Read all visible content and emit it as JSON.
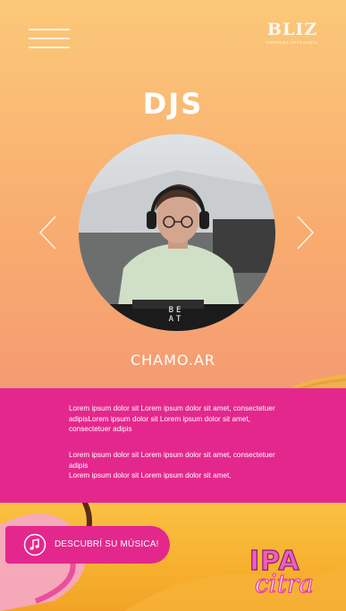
{
  "header": {
    "logo_text": "BLIZ",
    "logo_subtext": "CERVEZA ARTESANAL"
  },
  "page_title": "DJS",
  "dj": {
    "name": "CHAMO.AR",
    "shirt_text": "BE AT"
  },
  "description": {
    "paragraph_1": "Lorem ipsum dolor sit Lorem ipsum dolor sit amet, consectetuer adipisLorem ipsum dolor sit Lorem ipsum dolor sit amet, consectetuer adipis",
    "paragraph_2": "Lorem ipsum dolor sit Lorem ipsum dolor sit amet, consectetuer adipis\nLorem ipsum dolor sit Lorem ipsum dolor sit amet,"
  },
  "cta": {
    "label": "DESCUBRÍ SU MÚSICA!",
    "icon": "music-note-icon"
  },
  "brand": {
    "line1": "IPA",
    "line2": "citra"
  },
  "colors": {
    "accent": "#e4278d",
    "background_top": "#fbc879",
    "background_bottom": "#f59c72"
  }
}
